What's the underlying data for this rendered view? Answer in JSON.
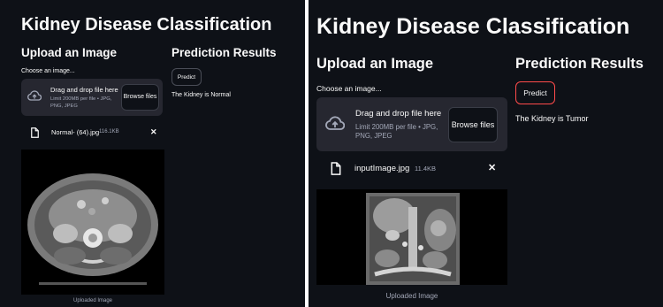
{
  "left": {
    "title": "Kidney Disease Classification",
    "upload_heading": "Upload an Image",
    "results_heading": "Prediction Results",
    "uploader_label": "Choose an image...",
    "dropzone_title": "Drag and drop file here",
    "dropzone_limit": "Limit 200MB per file • JPG, PNG, JPEG",
    "browse_label": "Browse files",
    "file_name": "Normal- (64).jpg",
    "file_size": "116.1KB",
    "remove_symbol": "✕",
    "predict_label": "Predict",
    "result_text": "The Kidney is Normal",
    "image_caption": "Uploaded Image"
  },
  "right": {
    "title": "Kidney Disease Classification",
    "upload_heading": "Upload an Image",
    "results_heading": "Prediction Results",
    "uploader_label": "Choose an image...",
    "dropzone_title": "Drag and drop file here",
    "dropzone_limit": "Limit 200MB per file • JPG, PNG, JPEG",
    "browse_label": "Browse files",
    "file_name": "inputImage.jpg",
    "file_size": "11.4KB",
    "remove_symbol": "✕",
    "predict_label": "Predict",
    "result_text": "The Kidney is Tumor",
    "image_caption": "Uploaded Image"
  },
  "icons": {
    "upload": "cloud-upload-icon",
    "file": "file-icon",
    "close": "close-icon"
  },
  "colors": {
    "app_background": "#0e1117",
    "dropzone_background": "#262730",
    "secondary_text": "#a3a8b8",
    "predict_border_active": "#ff4b4b"
  }
}
